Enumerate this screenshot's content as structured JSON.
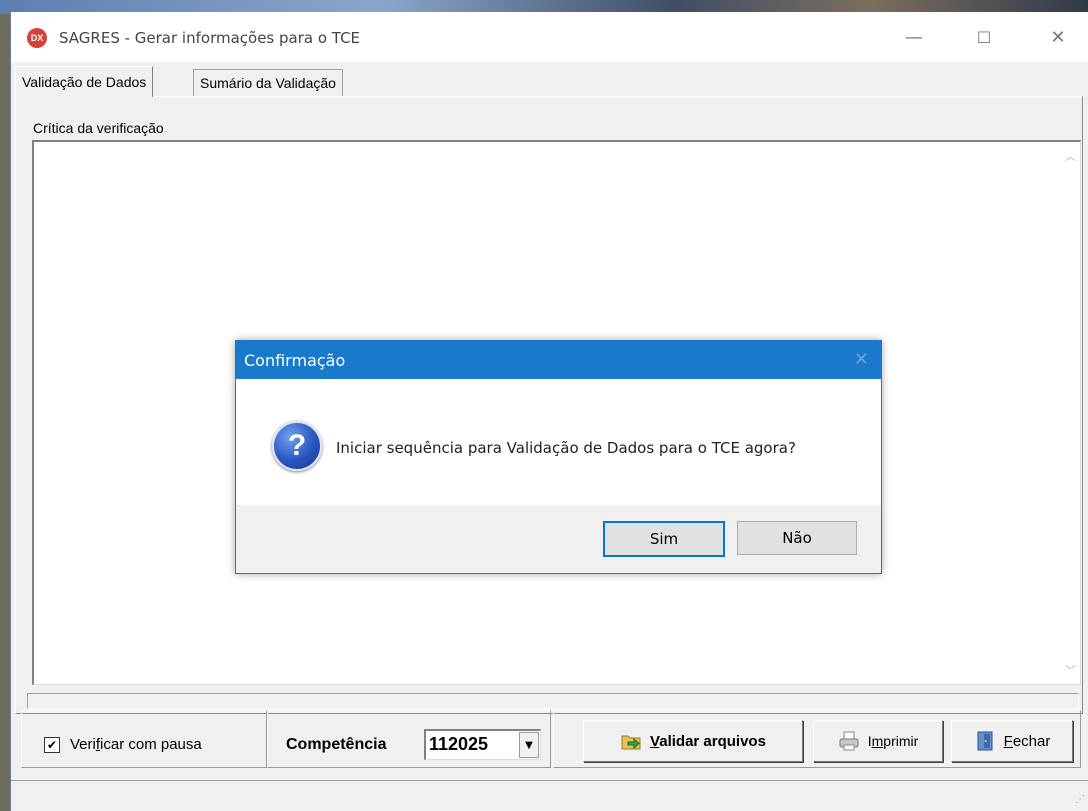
{
  "window": {
    "title": "SAGRES - Gerar informações para o TCE",
    "app_icon_text": "DX",
    "controls": {
      "minimize": "—",
      "maximize": "☐",
      "close": "✕"
    }
  },
  "tabs": [
    {
      "label": "Validação de Dados",
      "active": true
    },
    {
      "label": "Sumário da Validação",
      "active": false
    }
  ],
  "main": {
    "group_label": "Crítica da verificação",
    "memo_text": "",
    "progress_percent": 0
  },
  "bottom": {
    "checkbox": {
      "checked": true,
      "mark": "✔",
      "label_pre": "Veri",
      "label_u": "f",
      "label_post": "icar com pausa"
    },
    "competencia_label": "Competência",
    "competencia_value": "112025",
    "validate_button": {
      "u": "V",
      "rest": "alidar arquivos"
    },
    "print_button": {
      "pre": "I",
      "u": "m",
      "post": "primir"
    },
    "close_button": {
      "u": "F",
      "rest": "echar"
    }
  },
  "dialog": {
    "title": "Confirmação",
    "close": "✕",
    "icon": "question-icon",
    "message": "Iniciar sequência para Validação de Dados para o TCE agora?",
    "yes_label": "Sim",
    "no_label": "Não"
  },
  "colors": {
    "dialog_title_bg": "#1979ca",
    "window_bg": "#f0f0f0",
    "focus_border": "#0078d7"
  }
}
